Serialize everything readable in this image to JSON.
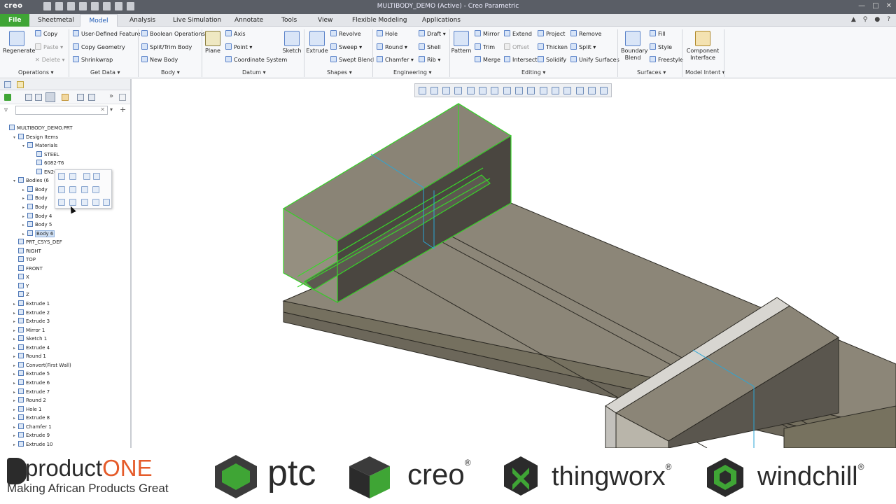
{
  "app": {
    "logo": "creo",
    "window_title": "MULTIBODY_DEMO (Active) - Creo Parametric"
  },
  "tabs": [
    "File",
    "Sheetmetal",
    "Model",
    "Analysis",
    "Live Simulation",
    "Annotate",
    "Tools",
    "View",
    "Flexible Modeling",
    "Applications"
  ],
  "active_tab": "Model",
  "ribbon": {
    "operations": {
      "regenerate": "Regenerate",
      "copy": "Copy",
      "paste": "Paste",
      "delete": "Delete",
      "group": "Operations"
    },
    "getdata": {
      "udf": "User-Defined Feature",
      "copy_geom": "Copy Geometry",
      "shrinkwrap": "Shrinkwrap",
      "group": "Get Data"
    },
    "body": {
      "boolean": "Boolean Operations",
      "split": "Split/Trim Body",
      "new": "New Body",
      "group": "Body"
    },
    "datum": {
      "plane": "Plane",
      "axis": "Axis",
      "point": "Point",
      "csys": "Coordinate System",
      "sketch": "Sketch",
      "group": "Datum"
    },
    "shapes": {
      "extrude": "Extrude",
      "revolve": "Revolve",
      "sweep": "Sweep",
      "swept_blend": "Swept Blend",
      "group": "Shapes"
    },
    "engineering": {
      "hole": "Hole",
      "draft": "Draft",
      "round": "Round",
      "shell": "Shell",
      "chamfer": "Chamfer",
      "rib": "Rib",
      "group": "Engineering"
    },
    "editing": {
      "pattern": "Pattern",
      "mirror": "Mirror",
      "extend": "Extend",
      "project": "Project",
      "remove": "Remove",
      "trim": "Trim",
      "offset": "Offset",
      "thicken": "Thicken",
      "split": "Split",
      "merge": "Merge",
      "intersect": "Intersect",
      "solidify": "Solidify",
      "unify": "Unify Surfaces",
      "group": "Editing"
    },
    "surfaces": {
      "boundary": "Boundary Blend",
      "fill": "Fill",
      "style": "Style",
      "freestyle": "Freestyle",
      "group": "Surfaces"
    },
    "intent": {
      "component": "Component Interface",
      "group": "Model Intent"
    }
  },
  "tree": [
    {
      "label": "MULTIBODY_DEMO.PRT",
      "level": 0,
      "tw": ""
    },
    {
      "label": "Design Items",
      "level": 1,
      "tw": "▾"
    },
    {
      "label": "Materials",
      "level": 2,
      "tw": "▾"
    },
    {
      "label": "STEEL",
      "level": 3,
      "tw": ""
    },
    {
      "label": "6082-T6",
      "level": 3,
      "tw": ""
    },
    {
      "label": "EN26",
      "level": 3,
      "tw": ""
    },
    {
      "label": "Bodies (6",
      "level": 1,
      "tw": "▾"
    },
    {
      "label": "Body",
      "level": 2,
      "tw": "▸"
    },
    {
      "label": "Body",
      "level": 2,
      "tw": "▸"
    },
    {
      "label": "Body",
      "level": 2,
      "tw": "▸"
    },
    {
      "label": "Body 4",
      "level": 2,
      "tw": "▸"
    },
    {
      "label": "Body 5",
      "level": 2,
      "tw": "▸"
    },
    {
      "label": "Body 6",
      "level": 2,
      "tw": "▸",
      "selected": true
    },
    {
      "label": "PRT_CSYS_DEF",
      "level": 1,
      "tw": ""
    },
    {
      "label": "RIGHT",
      "level": 1,
      "tw": ""
    },
    {
      "label": "TOP",
      "level": 1,
      "tw": ""
    },
    {
      "label": "FRONT",
      "level": 1,
      "tw": ""
    },
    {
      "label": "X",
      "level": 1,
      "tw": ""
    },
    {
      "label": "Y",
      "level": 1,
      "tw": ""
    },
    {
      "label": "Z",
      "level": 1,
      "tw": ""
    },
    {
      "label": "Extrude 1",
      "level": 1,
      "tw": "▸"
    },
    {
      "label": "Extrude 2",
      "level": 1,
      "tw": "▸"
    },
    {
      "label": "Extrude 3",
      "level": 1,
      "tw": "▸"
    },
    {
      "label": "Mirror 1",
      "level": 1,
      "tw": "▸"
    },
    {
      "label": "Sketch 1",
      "level": 1,
      "tw": "▸"
    },
    {
      "label": "Extrude 4",
      "level": 1,
      "tw": "▸"
    },
    {
      "label": "Round 1",
      "level": 1,
      "tw": "▸"
    },
    {
      "label": "Convert(First Wall)",
      "level": 1,
      "tw": "▸"
    },
    {
      "label": "Extrude 5",
      "level": 1,
      "tw": "▸"
    },
    {
      "label": "Extrude 6",
      "level": 1,
      "tw": "▸"
    },
    {
      "label": "Extrude 7",
      "level": 1,
      "tw": "▸"
    },
    {
      "label": "Round 2",
      "level": 1,
      "tw": "▸"
    },
    {
      "label": "Hole 1",
      "level": 1,
      "tw": "▸"
    },
    {
      "label": "Extrude 8",
      "level": 1,
      "tw": "▸"
    },
    {
      "label": "Chamfer 1",
      "level": 1,
      "tw": "▸"
    },
    {
      "label": "Extrude 9",
      "level": 1,
      "tw": "▸"
    },
    {
      "label": "Extrude 10",
      "level": 1,
      "tw": "▸"
    }
  ],
  "banner": {
    "product": "product",
    "one": "ONE",
    "tagline": "Making African Products Great",
    "ptc": "ptc",
    "creo": "creo",
    "thingworx": "thingworx",
    "windchill": "windchill",
    "reg": "®"
  },
  "colors": {
    "accent_green": "#3fa535",
    "title_bar": "#5a5e66",
    "selection_green": "#39d82a",
    "model_face": "#8a8476"
  }
}
